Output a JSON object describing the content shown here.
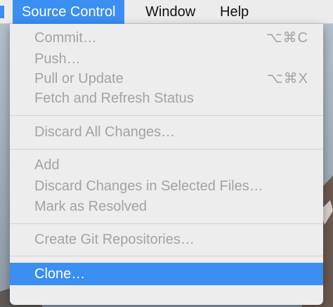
{
  "menubar": {
    "items": [
      {
        "label": "Source Control",
        "active": true
      },
      {
        "label": "Window",
        "active": false
      },
      {
        "label": "Help",
        "active": false
      }
    ]
  },
  "source_control_menu": {
    "items": [
      {
        "label": "Commit…",
        "shortcut": "⌥⌘C",
        "enabled": false
      },
      {
        "label": "Push…",
        "shortcut": "",
        "enabled": false
      },
      {
        "label": "Pull or Update",
        "shortcut": "⌥⌘X",
        "enabled": false
      },
      {
        "label": "Fetch and Refresh Status",
        "shortcut": "",
        "enabled": false
      },
      {
        "label": "Discard All Changes…",
        "shortcut": "",
        "enabled": false
      },
      {
        "label": "Add",
        "shortcut": "",
        "enabled": false
      },
      {
        "label": "Discard Changes in Selected Files…",
        "shortcut": "",
        "enabled": false
      },
      {
        "label": "Mark as Resolved",
        "shortcut": "",
        "enabled": false
      },
      {
        "label": "Create Git Repositories…",
        "shortcut": "",
        "enabled": false
      },
      {
        "label": "Clone…",
        "shortcut": "",
        "enabled": true
      }
    ]
  },
  "colors": {
    "highlight": "#3b8ff0",
    "disabled_text": "#a3a3a3",
    "menu_background": "#ededed"
  }
}
